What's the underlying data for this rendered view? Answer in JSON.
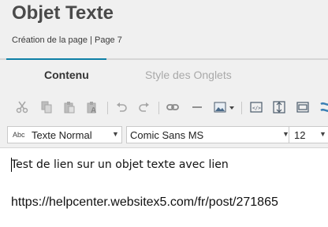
{
  "header": {
    "title": "Objet Texte",
    "subtitle": "Création de la page | Page 7"
  },
  "tabs": [
    {
      "label": "Contenu",
      "active": true
    },
    {
      "label": "Style des Onglets",
      "active": false
    }
  ],
  "toolbar": {
    "icons": [
      "cut-icon",
      "copy-icon",
      "paste-icon",
      "paste-text-icon",
      "undo-icon",
      "redo-icon",
      "link-icon",
      "horizontal-line-icon",
      "image-icon",
      "html-code-icon",
      "line-height-icon",
      "layout-icon",
      "special-icon"
    ]
  },
  "format": {
    "style_prefix": "Abc",
    "style_value": "Texte Normal",
    "font_value": "Comic Sans MS",
    "size_value": "12"
  },
  "editor": {
    "line1": "Test de lien sur un objet texte avec lien",
    "line2": "https://helpcenter.websitex5.com/fr/post/271865"
  },
  "colors": {
    "accent": "#0e7fa6",
    "panel_bg": "#f0f0f0",
    "disabled_icon": "#a6a6a6",
    "active_icon": "#4a5a6a"
  }
}
